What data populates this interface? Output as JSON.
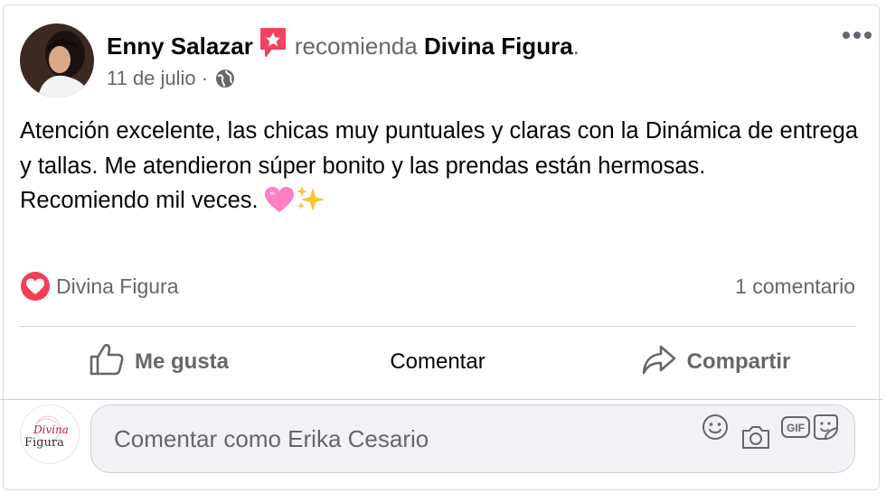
{
  "post": {
    "author": "Enny Salazar",
    "recommends_text": "recomienda",
    "page_name": "Divina Figura",
    "trailing_dot": ".",
    "date": "11 de julio",
    "date_separator": "·",
    "body_lines": [
      "Atención excelente, las chicas muy puntuales y claras con la Dinámica de entrega y tallas. Me atendieron súper bonito y las prendas están hermosas.",
      "Recomiendo mil veces."
    ],
    "reactions_label": "Divina Figura",
    "comments_count": "1 comentario"
  },
  "actions": {
    "like": "Me gusta",
    "comment": "Comentar",
    "share": "Compartir"
  },
  "comment_box": {
    "placeholder": "Comentar como Erika Cesario",
    "avatar_brand_top": "Divina",
    "avatar_brand_bottom": "Figura"
  },
  "colors": {
    "secondary_text": "#65676b",
    "primary_text": "#050505",
    "recommend_badge": "#f3425f",
    "love_reaction": "#f33e58",
    "input_bg": "#f0f2f5"
  },
  "icons": {
    "recommend": "recommend-badge-icon",
    "globe": "globe-icon",
    "more": "more-icon",
    "love": "love-reaction-icon",
    "like": "thumbs-up-icon",
    "share": "share-arrow-icon",
    "emoji": "smiley-icon",
    "camera": "camera-icon",
    "gif": "gif-icon",
    "sticker": "sticker-icon",
    "heart_emoji": "pink-heart-emoji",
    "sparkles_emoji": "sparkles-emoji"
  }
}
